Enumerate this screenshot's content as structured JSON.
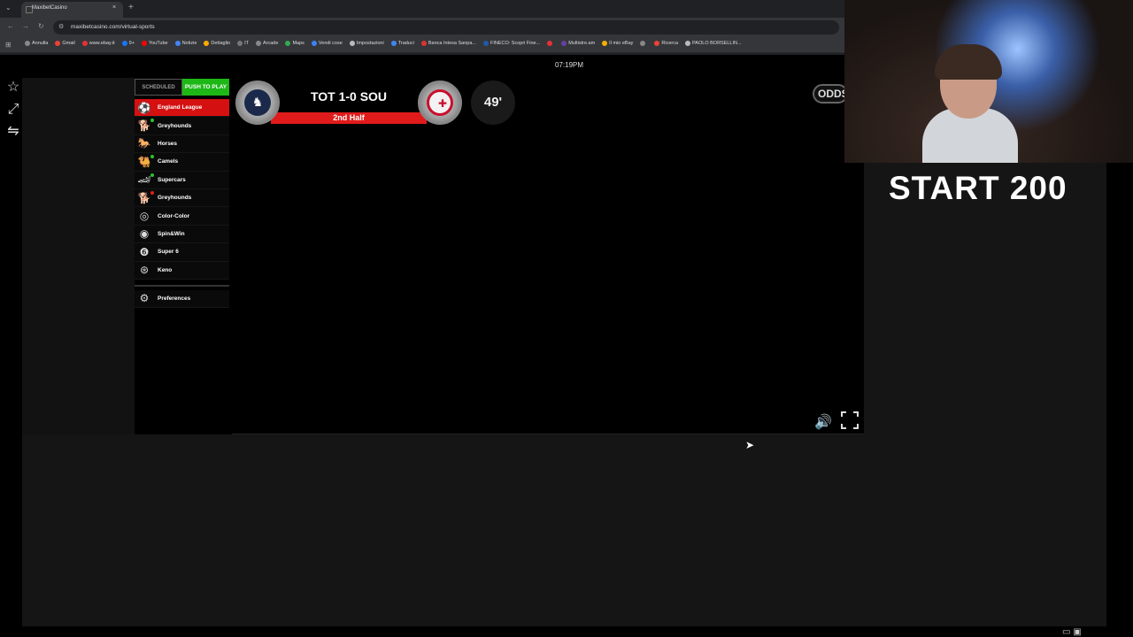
{
  "browser": {
    "tab_title": "MaxibetCasino",
    "tab_close": "×",
    "new_tab": "+",
    "url": "maxibetcasino.com/virtual-sports",
    "bookmarks": [
      {
        "label": "Annulla",
        "color": "#888888"
      },
      {
        "label": "Gmail",
        "color": "#ea4335"
      },
      {
        "label": "www.ebay.it",
        "color": "#e53238"
      },
      {
        "label": "9+",
        "color": "#1877f2"
      },
      {
        "label": "YouTube",
        "color": "#ff0000"
      },
      {
        "label": "Notizie",
        "color": "#4285f4"
      },
      {
        "label": "Dettaglio",
        "color": "#ffaa00"
      },
      {
        "label": "IT",
        "color": "#777777"
      },
      {
        "label": "Arcade",
        "color": "#888888"
      },
      {
        "label": "Maps",
        "color": "#34a853"
      },
      {
        "label": "Vendi cose",
        "color": "#3b82f6"
      },
      {
        "label": "Impostazioni",
        "color": "#bbbbbb"
      },
      {
        "label": "Traduci",
        "color": "#4285f4"
      },
      {
        "label": "Banca Intesa Sanpa...",
        "color": "#d33"
      },
      {
        "label": "FINECO: Scopri Fine...",
        "color": "#1e5aa8"
      },
      {
        "label": "",
        "color": "#e53238"
      },
      {
        "label": "Multistre.am",
        "color": "#6441a5"
      },
      {
        "label": "Il mio eBay",
        "color": "#f5af02"
      },
      {
        "label": "",
        "color": "#888888"
      },
      {
        "label": "Ricerca",
        "color": "#ea4335"
      },
      {
        "label": "PAOLO BORSELLIN...",
        "color": "#bbbbbb"
      }
    ]
  },
  "clock": "07:19PM",
  "menu": {
    "scheduled_label": "SCHEDULED",
    "push_label": "PUSH TO PLAY",
    "items": [
      {
        "label": "England League",
        "icon": "⚽",
        "active": true,
        "dot": ""
      },
      {
        "label": "Greyhounds",
        "icon": "🐕",
        "active": false,
        "dot": "green"
      },
      {
        "label": "Horses",
        "icon": "🐎",
        "active": false,
        "dot": ""
      },
      {
        "label": "Camels",
        "icon": "🐫",
        "active": false,
        "dot": "green"
      },
      {
        "label": "Supercars",
        "icon": "🏎",
        "active": false,
        "dot": "green"
      },
      {
        "label": "Greyhounds",
        "icon": "🐕",
        "active": false,
        "dot": "red"
      },
      {
        "label": "Color-Color",
        "icon": "◎",
        "active": false,
        "dot": ""
      },
      {
        "label": "Spin&Win",
        "icon": "◉",
        "active": false,
        "dot": ""
      },
      {
        "label": "Super 6",
        "icon": "❻",
        "active": false,
        "dot": ""
      },
      {
        "label": "Keno",
        "icon": "⊛",
        "active": false,
        "dot": ""
      }
    ],
    "preferences_label": "Preferences"
  },
  "scoreboard": {
    "score": "TOT 1-0 SOU",
    "period": "2nd Half",
    "minute": "49'",
    "odds_button": "ODDS"
  },
  "overlay": {
    "start_text": "START 200"
  }
}
